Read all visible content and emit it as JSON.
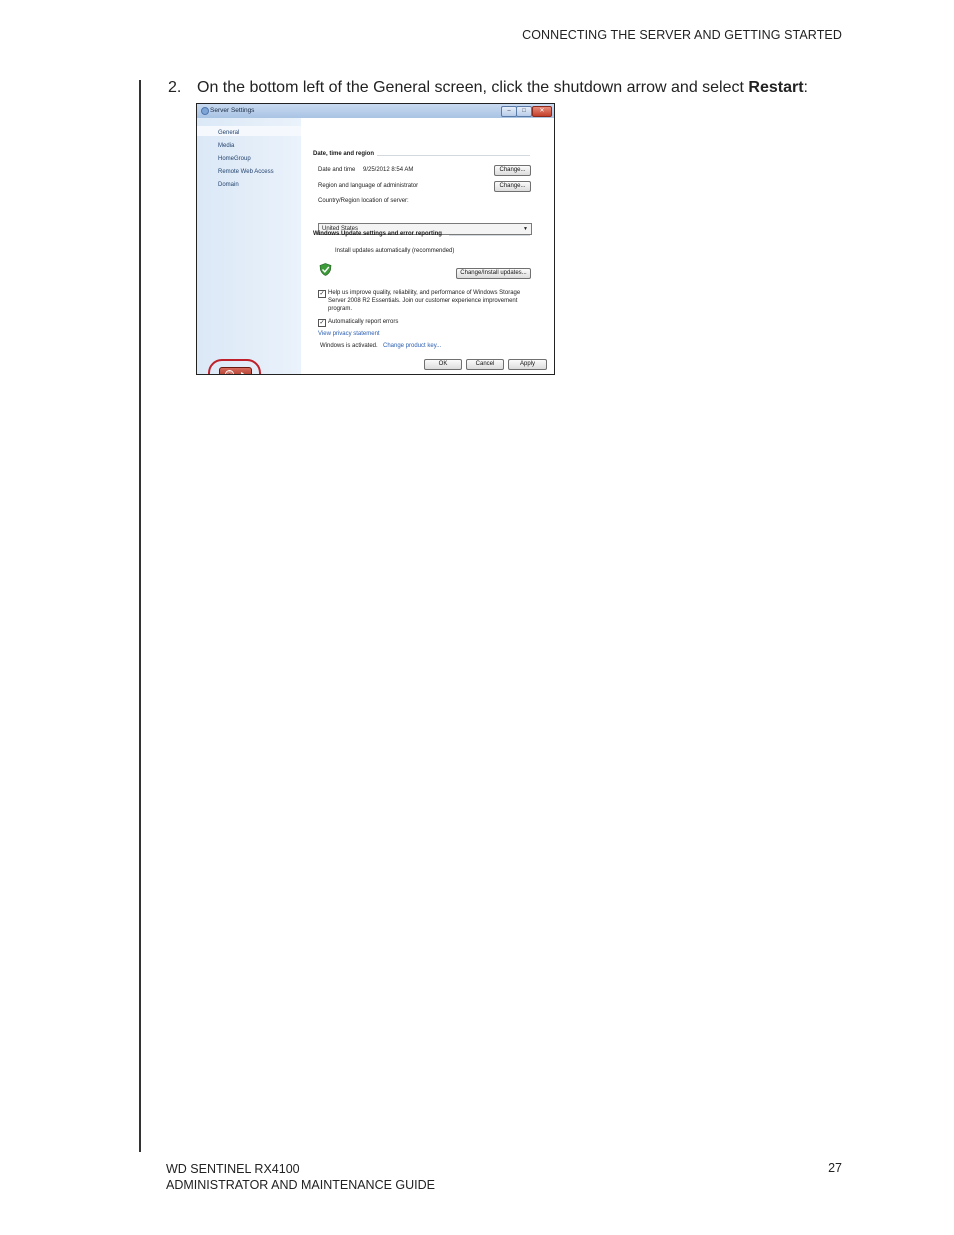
{
  "header": {
    "title": "CONNECTING THE SERVER AND GETTING STARTED"
  },
  "step": {
    "number": "2.",
    "text": "On the bottom left of the General screen, click the shutdown arrow and select ",
    "bold": "Restart",
    "end": ":"
  },
  "window": {
    "title": "Server Settings",
    "controls": {
      "minimize": "–",
      "maximize": "□",
      "close": "✕"
    },
    "nav": [
      "General",
      "Media",
      "HomeGroup",
      "Remote Web Access",
      "Domain"
    ],
    "date_section": {
      "heading": "Date, time and region",
      "date_label": "Date and time",
      "date_value": "9/25/2012 8:54 AM",
      "change1": "Change...",
      "region_label": "Region and language of administrator",
      "change2": "Change...",
      "country_label": "Country/Region location of server:",
      "country_value": "United States"
    },
    "update_section": {
      "heading": "Windows Update settings and error reporting",
      "auto_text": "Install updates automatically (recommended)",
      "change_updates": "Change/Install updates...",
      "help_line1": "Help us improve quality, reliability, and performance of Windows Storage",
      "help_line2": "Server 2008 R2 Essentials. Join our customer experience improvement",
      "help_line3": "program.",
      "auto_report": "Automatically report errors",
      "privacy_link": "View privacy statement",
      "activated": "Windows is activated.",
      "product_key_link": "Change product key..."
    },
    "buttons": {
      "ok": "OK",
      "cancel": "Cancel",
      "apply": "Apply"
    },
    "icons": {
      "power": "power-icon",
      "arrow": "arrow-right-icon",
      "shield": "shield-check-icon"
    }
  },
  "footer": {
    "product": "WD SENTINEL RX4100",
    "guide": "ADMINISTRATOR AND MAINTENANCE GUIDE",
    "page": "27"
  }
}
